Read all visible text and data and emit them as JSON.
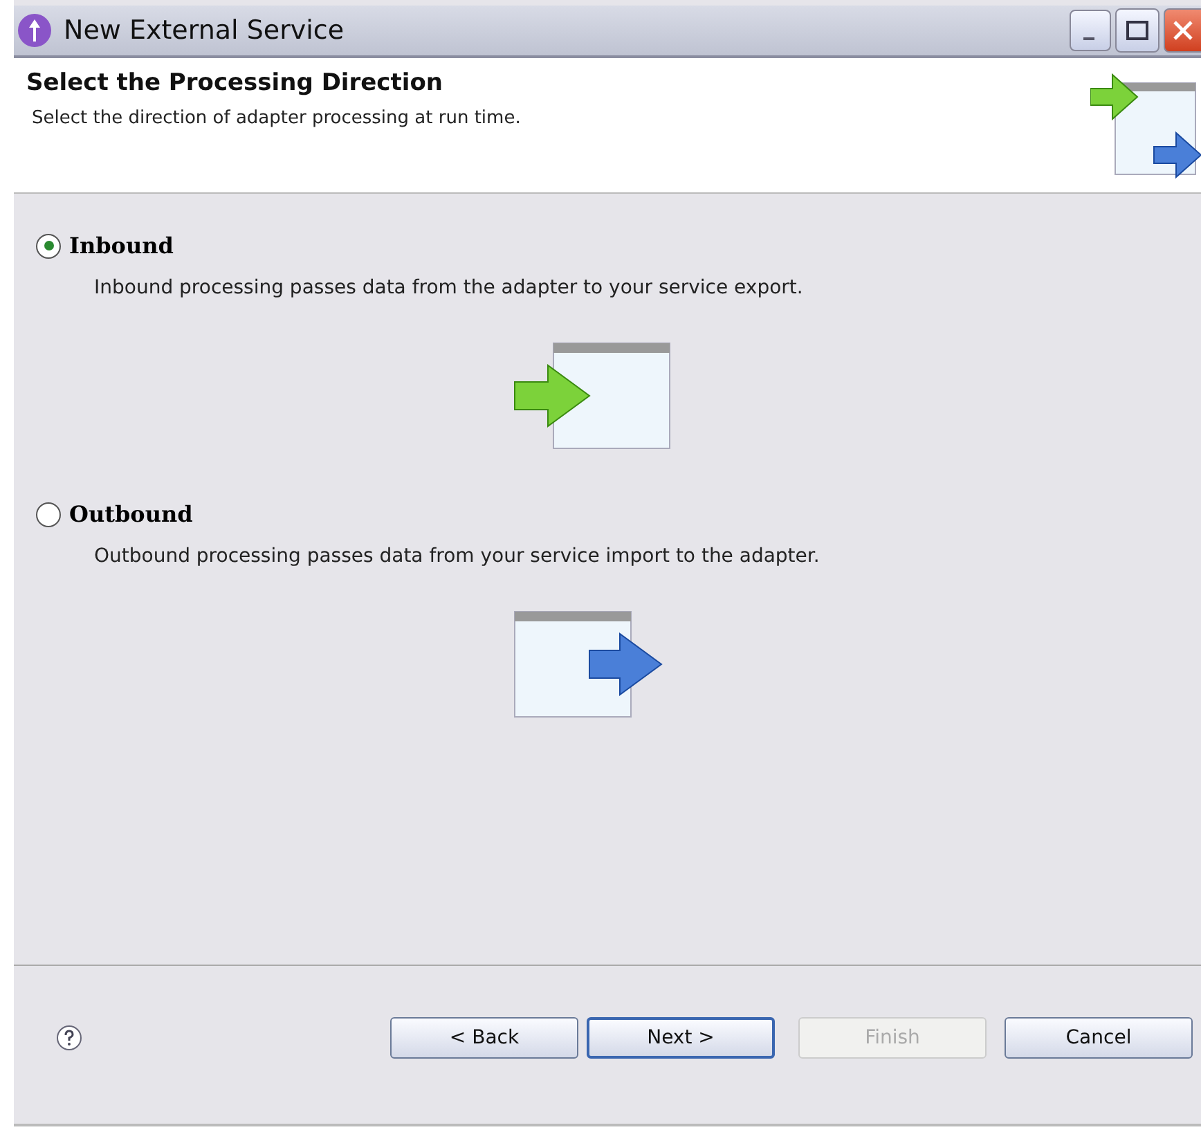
{
  "window": {
    "title": "New External Service"
  },
  "header": {
    "title": "Select the Processing Direction",
    "description": "Select the direction of adapter processing at run time."
  },
  "options": [
    {
      "label": "Inbound",
      "selected": true,
      "kind": "inbound",
      "description": "Inbound processing passes data from the adapter to your service export."
    },
    {
      "label": "Outbound",
      "selected": false,
      "kind": "outbound",
      "description": "Outbound processing passes data from your service import to the adapter."
    }
  ],
  "buttons": [
    {
      "label": "< Back",
      "disabled": false,
      "default": false
    },
    {
      "label": "Next >",
      "disabled": false,
      "default": true
    },
    {
      "label": "Finish",
      "disabled": true,
      "default": false
    },
    {
      "label": "Cancel",
      "disabled": false,
      "default": false
    }
  ]
}
